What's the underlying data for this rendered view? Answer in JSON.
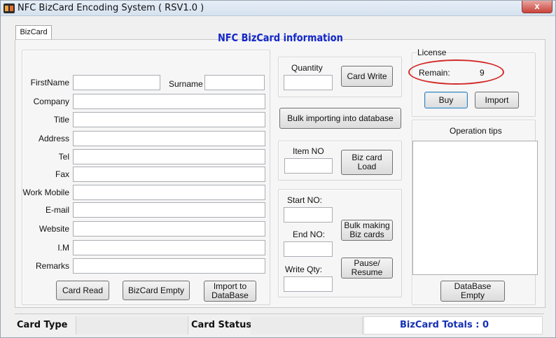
{
  "window": {
    "title": "NFC BizCard Encoding System ( RSV1.0 )",
    "close_label": "x"
  },
  "tab": {
    "label": "BizCard"
  },
  "heading": "NFC BizCard information",
  "fields": {
    "firstname": "FirstName",
    "surname": "Surname",
    "company": "Company",
    "title": "Title",
    "address": "Address",
    "tel": "Tel",
    "fax": "Fax",
    "work_mobile": "Work Mobile",
    "email": "E-mail",
    "website": "Website",
    "im": "I.M",
    "remarks": "Remarks"
  },
  "buttons": {
    "card_read": "Card Read",
    "bizcard_empty": "BizCard Empty",
    "import_to_db_1": "Import to",
    "import_to_db_2": "DataBase",
    "card_write": "Card Write",
    "bulk_import": "Bulk importing into database",
    "biz_card_load": "Biz card Load",
    "bulk_making_1": "Bulk making",
    "bulk_making_2": "Biz cards",
    "pause_1": "Pause/",
    "pause_2": "Resume",
    "buy": "Buy",
    "import": "Import",
    "database_empty": "DataBase Empty"
  },
  "middle": {
    "quantity": "Quantity",
    "item_no": "Item NO",
    "start_no": "Start NO:",
    "end_no": "End NO:",
    "write_qty": "Write Qty:"
  },
  "license": {
    "legend": "License",
    "remain_label": "Remain:",
    "remain_value": "9"
  },
  "operation_tips": "Operation tips",
  "statusbar": {
    "card_type": "Card Type",
    "card_status": "Card Status",
    "totals": "BizCard Totals : 0"
  },
  "colors": {
    "heading": "#1428c8",
    "highlight": "#d42a2a",
    "totals": "#1430b4"
  }
}
